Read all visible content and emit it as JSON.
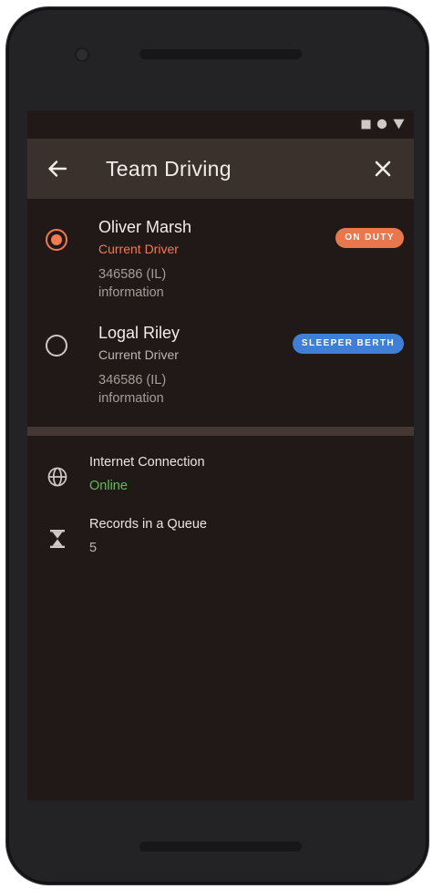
{
  "app": {
    "title": "Team Driving",
    "colors": {
      "accent": "#f07a52",
      "background": "#211917",
      "app_bar": "#3a302c",
      "online": "#5fbf56"
    }
  },
  "status_bar": {
    "icons": [
      "square-icon",
      "circle-icon",
      "triangle-down-icon"
    ]
  },
  "header": {
    "back_icon": "back-arrow-icon",
    "title": "Team Driving",
    "close_icon": "close-icon"
  },
  "drivers": [
    {
      "name": "Oliver Marsh",
      "role": "Current Driver",
      "id_line": "346586 (IL)",
      "info_line": "information",
      "selected": true,
      "badge": "ON DUTY",
      "badge_color": "#e8774e"
    },
    {
      "name": "Logal Riley",
      "role": "Current Driver",
      "id_line": "346586 (IL)",
      "info_line": "information",
      "selected": false,
      "badge": "SLEEPER BERTH",
      "badge_color": "#3f7fd6"
    }
  ],
  "status": {
    "internet": {
      "icon": "globe-icon",
      "label": "Internet Connection",
      "value": "Online",
      "value_color": "#5fbf56"
    },
    "queue": {
      "icon": "hourglass-icon",
      "label": "Records in a Queue",
      "value": "5"
    }
  }
}
